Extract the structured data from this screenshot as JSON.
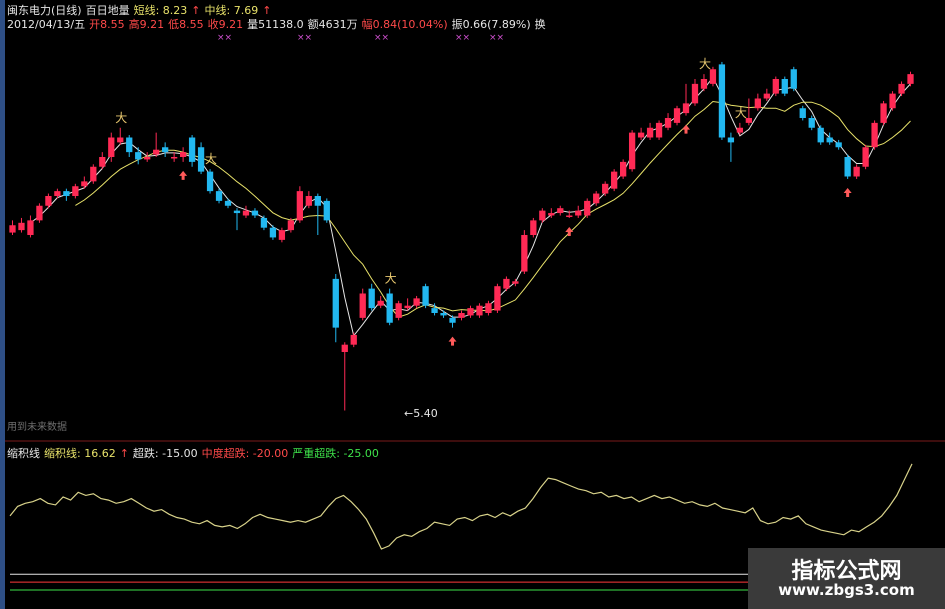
{
  "header": {
    "line1": [
      {
        "text": "闽东电力(日线)",
        "color": "#e6e6e6"
      },
      {
        "text": "百日地量",
        "color": "#e6e6e6"
      },
      {
        "text": "短线: 8.23",
        "color": "#e8e26a"
      },
      {
        "text": "↑",
        "color": "#ff4a4a"
      },
      {
        "text": "中线: 7.69",
        "color": "#e8e26a"
      },
      {
        "text": "↑",
        "color": "#ff4a4a"
      }
    ],
    "line2": [
      {
        "text": "2012/04/13/五",
        "color": "#e6e6e6"
      },
      {
        "text": "开8.55",
        "color": "#ff4a4a"
      },
      {
        "text": "高9.21",
        "color": "#ff4a4a"
      },
      {
        "text": "低8.55",
        "color": "#ff4a4a"
      },
      {
        "text": "收9.21",
        "color": "#ff4a4a"
      },
      {
        "text": "量51138.0",
        "color": "#e6e6e6"
      },
      {
        "text": "额4631万",
        "color": "#e6e6e6"
      },
      {
        "text": "幅0.84(10.04%)",
        "color": "#ff4a4a"
      },
      {
        "text": "振0.66(7.89%)",
        "color": "#e6e6e6"
      },
      {
        "text": "换",
        "color": "#e6e6e6"
      }
    ]
  },
  "main_chart": {
    "future_label": "用到未来数据",
    "low_price_label": "←5.40",
    "signal_marks": "××",
    "top_marks": "大"
  },
  "indicator": {
    "labels": [
      {
        "text": "缩积线",
        "color": "#e6e6e6"
      },
      {
        "text": "缩积线: 16.62",
        "color": "#e8e26a"
      },
      {
        "text": "↑",
        "color": "#ff4a4a"
      },
      {
        "text": "超跌: -15.00",
        "color": "#e6e6e6"
      },
      {
        "text": "中度超跌: -20.00",
        "color": "#ff4a4a"
      },
      {
        "text": "严重超跌: -25.00",
        "color": "#3ee24a"
      }
    ]
  },
  "watermark": {
    "line1": "指标公式网",
    "line2": "www.zbgs3.com"
  },
  "chart_data": {
    "type": "candlestick",
    "candles": [
      {
        "o": 9.05,
        "c": 9.2,
        "h": 9.3,
        "l": 9.0
      },
      {
        "o": 9.1,
        "c": 9.25,
        "h": 9.35,
        "l": 9.05
      },
      {
        "o": 9.0,
        "c": 9.3,
        "h": 9.4,
        "l": 8.95
      },
      {
        "o": 9.3,
        "c": 9.6,
        "h": 9.65,
        "l": 9.25
      },
      {
        "o": 9.6,
        "c": 9.8,
        "h": 9.85,
        "l": 9.55
      },
      {
        "o": 9.8,
        "c": 9.9,
        "h": 9.95,
        "l": 9.75
      },
      {
        "o": 9.9,
        "c": 9.8,
        "h": 9.95,
        "l": 9.7
      },
      {
        "o": 9.8,
        "c": 10.0,
        "h": 10.05,
        "l": 9.75
      },
      {
        "o": 10.0,
        "c": 10.1,
        "h": 10.2,
        "l": 9.95
      },
      {
        "o": 10.1,
        "c": 10.4,
        "h": 10.45,
        "l": 10.05
      },
      {
        "o": 10.4,
        "c": 10.6,
        "h": 10.7,
        "l": 10.35
      },
      {
        "o": 10.6,
        "c": 11.0,
        "h": 11.1,
        "l": 10.5
      },
      {
        "o": 10.9,
        "c": 11.0,
        "h": 11.2,
        "l": 10.85
      },
      {
        "o": 11.0,
        "c": 10.7,
        "h": 11.05,
        "l": 10.6
      },
      {
        "o": 10.7,
        "c": 10.55,
        "h": 10.8,
        "l": 10.45
      },
      {
        "o": 10.55,
        "c": 10.6,
        "h": 10.7,
        "l": 10.5
      },
      {
        "o": 10.65,
        "c": 10.75,
        "h": 11.1,
        "l": 10.6
      },
      {
        "o": 10.8,
        "c": 10.7,
        "h": 10.9,
        "l": 10.6
      },
      {
        "o": 10.6,
        "c": 10.6,
        "h": 10.7,
        "l": 10.5
      },
      {
        "o": 10.6,
        "c": 10.7,
        "h": 10.8,
        "l": 10.5
      },
      {
        "o": 11.0,
        "c": 10.5,
        "h": 11.05,
        "l": 10.4
      },
      {
        "o": 10.8,
        "c": 10.3,
        "h": 10.9,
        "l": 10.25
      },
      {
        "o": 10.3,
        "c": 9.9,
        "h": 10.35,
        "l": 9.85
      },
      {
        "o": 9.9,
        "c": 9.7,
        "h": 9.95,
        "l": 9.65
      },
      {
        "o": 9.7,
        "c": 9.6,
        "h": 9.75,
        "l": 9.55
      },
      {
        "o": 9.5,
        "c": 9.45,
        "h": 9.55,
        "l": 9.1
      },
      {
        "o": 9.4,
        "c": 9.5,
        "h": 9.6,
        "l": 9.35
      },
      {
        "o": 9.5,
        "c": 9.4,
        "h": 9.55,
        "l": 9.35
      },
      {
        "o": 9.35,
        "c": 9.15,
        "h": 9.4,
        "l": 9.1
      },
      {
        "o": 9.15,
        "c": 8.95,
        "h": 9.2,
        "l": 8.9
      },
      {
        "o": 8.9,
        "c": 9.1,
        "h": 9.15,
        "l": 8.85
      },
      {
        "o": 9.1,
        "c": 9.3,
        "h": 9.35,
        "l": 9.05
      },
      {
        "o": 9.3,
        "c": 9.9,
        "h": 10.0,
        "l": 9.25
      },
      {
        "o": 9.6,
        "c": 9.8,
        "h": 9.9,
        "l": 9.55
      },
      {
        "o": 9.8,
        "c": 9.6,
        "h": 9.85,
        "l": 9.0
      },
      {
        "o": 9.7,
        "c": 9.3,
        "h": 9.75,
        "l": 9.25
      },
      {
        "o": 8.1,
        "c": 7.1,
        "h": 8.2,
        "l": 6.8
      },
      {
        "o": 6.6,
        "c": 6.75,
        "h": 6.8,
        "l": 5.4
      },
      {
        "o": 6.75,
        "c": 6.95,
        "h": 7.0,
        "l": 6.7
      },
      {
        "o": 7.3,
        "c": 7.8,
        "h": 7.9,
        "l": 7.25
      },
      {
        "o": 7.9,
        "c": 7.5,
        "h": 8.0,
        "l": 7.45
      },
      {
        "o": 7.55,
        "c": 7.65,
        "h": 7.75,
        "l": 7.5
      },
      {
        "o": 7.8,
        "c": 7.2,
        "h": 7.9,
        "l": 7.15
      },
      {
        "o": 7.3,
        "c": 7.6,
        "h": 7.65,
        "l": 7.25
      },
      {
        "o": 7.5,
        "c": 7.55,
        "h": 7.7,
        "l": 7.45
      },
      {
        "o": 7.55,
        "c": 7.7,
        "h": 7.75,
        "l": 7.5
      },
      {
        "o": 7.95,
        "c": 7.55,
        "h": 8.0,
        "l": 7.5
      },
      {
        "o": 7.5,
        "c": 7.4,
        "h": 7.6,
        "l": 7.35
      },
      {
        "o": 7.4,
        "c": 7.35,
        "h": 7.45,
        "l": 7.3
      },
      {
        "o": 7.3,
        "c": 7.2,
        "h": 7.35,
        "l": 7.1
      },
      {
        "o": 7.3,
        "c": 7.4,
        "h": 7.45,
        "l": 7.25
      },
      {
        "o": 7.35,
        "c": 7.5,
        "h": 7.55,
        "l": 7.3
      },
      {
        "o": 7.35,
        "c": 7.55,
        "h": 7.6,
        "l": 7.3
      },
      {
        "o": 7.4,
        "c": 7.6,
        "h": 7.65,
        "l": 7.35
      },
      {
        "o": 7.45,
        "c": 7.95,
        "h": 8.0,
        "l": 7.4
      },
      {
        "o": 7.9,
        "c": 8.1,
        "h": 8.15,
        "l": 7.85
      },
      {
        "o": 8.0,
        "c": 8.05,
        "h": 8.1,
        "l": 7.95
      },
      {
        "o": 8.25,
        "c": 9.0,
        "h": 9.1,
        "l": 8.2
      },
      {
        "o": 9.0,
        "c": 9.3,
        "h": 9.35,
        "l": 8.95
      },
      {
        "o": 9.3,
        "c": 9.5,
        "h": 9.55,
        "l": 9.25
      },
      {
        "o": 9.4,
        "c": 9.45,
        "h": 9.55,
        "l": 9.35
      },
      {
        "o": 9.45,
        "c": 9.55,
        "h": 9.6,
        "l": 9.4
      },
      {
        "o": 9.4,
        "c": 9.4,
        "h": 9.5,
        "l": 9.35
      },
      {
        "o": 9.4,
        "c": 9.5,
        "h": 9.6,
        "l": 9.35
      },
      {
        "o": 9.4,
        "c": 9.7,
        "h": 9.75,
        "l": 9.35
      },
      {
        "o": 9.65,
        "c": 9.85,
        "h": 9.9,
        "l": 9.6
      },
      {
        "o": 9.85,
        "c": 10.05,
        "h": 10.1,
        "l": 9.8
      },
      {
        "o": 9.95,
        "c": 10.3,
        "h": 10.35,
        "l": 9.9
      },
      {
        "o": 10.2,
        "c": 10.5,
        "h": 10.55,
        "l": 10.15
      },
      {
        "o": 10.35,
        "c": 11.1,
        "h": 11.15,
        "l": 10.3
      },
      {
        "o": 11.0,
        "c": 11.1,
        "h": 11.2,
        "l": 10.95
      },
      {
        "o": 11.0,
        "c": 11.2,
        "h": 11.3,
        "l": 10.95
      },
      {
        "o": 11.0,
        "c": 11.3,
        "h": 11.35,
        "l": 10.95
      },
      {
        "o": 11.2,
        "c": 11.4,
        "h": 11.5,
        "l": 11.15
      },
      {
        "o": 11.3,
        "c": 11.6,
        "h": 11.65,
        "l": 11.25
      },
      {
        "o": 11.5,
        "c": 11.7,
        "h": 12.1,
        "l": 11.45
      },
      {
        "o": 11.7,
        "c": 12.1,
        "h": 12.2,
        "l": 11.65
      },
      {
        "o": 12.0,
        "c": 12.2,
        "h": 12.3,
        "l": 11.95
      },
      {
        "o": 12.1,
        "c": 12.4,
        "h": 12.45,
        "l": 12.05
      },
      {
        "o": 12.5,
        "c": 11.0,
        "h": 12.55,
        "l": 10.95
      },
      {
        "o": 11.0,
        "c": 10.9,
        "h": 11.1,
        "l": 10.5
      },
      {
        "o": 11.1,
        "c": 11.2,
        "h": 11.3,
        "l": 11.05
      },
      {
        "o": 11.3,
        "c": 11.4,
        "h": 11.8,
        "l": 11.25
      },
      {
        "o": 11.6,
        "c": 11.8,
        "h": 11.9,
        "l": 11.55
      },
      {
        "o": 11.8,
        "c": 11.9,
        "h": 12.0,
        "l": 11.75
      },
      {
        "o": 11.9,
        "c": 12.2,
        "h": 12.25,
        "l": 11.85
      },
      {
        "o": 12.2,
        "c": 11.9,
        "h": 12.25,
        "l": 11.85
      },
      {
        "o": 12.4,
        "c": 12.0,
        "h": 12.45,
        "l": 11.95
      },
      {
        "o": 11.6,
        "c": 11.4,
        "h": 11.65,
        "l": 11.35
      },
      {
        "o": 11.4,
        "c": 11.2,
        "h": 11.45,
        "l": 11.15
      },
      {
        "o": 11.2,
        "c": 10.9,
        "h": 11.25,
        "l": 10.85
      },
      {
        "o": 11.0,
        "c": 10.9,
        "h": 11.1,
        "l": 10.85
      },
      {
        "o": 10.9,
        "c": 10.8,
        "h": 10.95,
        "l": 10.75
      },
      {
        "o": 10.6,
        "c": 10.2,
        "h": 10.65,
        "l": 10.15
      },
      {
        "o": 10.2,
        "c": 10.4,
        "h": 10.45,
        "l": 10.15
      },
      {
        "o": 10.4,
        "c": 10.8,
        "h": 10.85,
        "l": 10.35
      },
      {
        "o": 10.8,
        "c": 11.3,
        "h": 11.35,
        "l": 10.75
      },
      {
        "o": 11.3,
        "c": 11.7,
        "h": 11.75,
        "l": 11.25
      },
      {
        "o": 11.6,
        "c": 11.9,
        "h": 11.95,
        "l": 11.55
      },
      {
        "o": 11.9,
        "c": 12.1,
        "h": 12.15,
        "l": 11.85
      },
      {
        "o": 12.1,
        "c": 12.3,
        "h": 12.35,
        "l": 12.05
      }
    ],
    "ylim": [
      5.0,
      13.0
    ],
    "oscillator": {
      "values": [
        22,
        28,
        30,
        31,
        33,
        30,
        29,
        34,
        32,
        37,
        35,
        36,
        33,
        32,
        30,
        31,
        33,
        30,
        27,
        25,
        26,
        23,
        21,
        20,
        18,
        17,
        19,
        16,
        15,
        16,
        14,
        17,
        21,
        23,
        21,
        20,
        19,
        18,
        19,
        18,
        20,
        22,
        28,
        33,
        35,
        31,
        26,
        20,
        11,
        1,
        3,
        8,
        10,
        9,
        12,
        14,
        18,
        17,
        16,
        20,
        21,
        19,
        22,
        23,
        21,
        24,
        22,
        25,
        27,
        33,
        40,
        46,
        45,
        43,
        41,
        39,
        38,
        36,
        37,
        34,
        35,
        33,
        34,
        31,
        33,
        35,
        33,
        34,
        32,
        30,
        31,
        29,
        28,
        30,
        27,
        26,
        25,
        24,
        27,
        19,
        17,
        18,
        21,
        20,
        22,
        17,
        15,
        13,
        12,
        11,
        10,
        13,
        12,
        15,
        18,
        22,
        28,
        35,
        45,
        55
      ],
      "ylim": [
        -25,
        60
      ],
      "levels": [
        -15,
        -20,
        -25
      ]
    }
  }
}
